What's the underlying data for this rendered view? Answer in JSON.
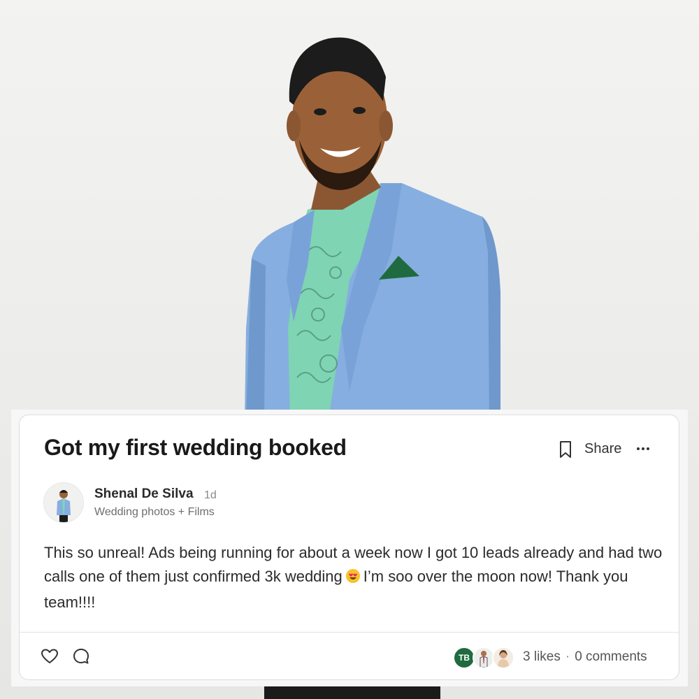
{
  "post": {
    "title": "Got my first wedding booked",
    "share_label": "Share",
    "author": {
      "name": "Shenal De Silva",
      "time": "1d",
      "subtitle": "Wedding photos + Films"
    },
    "body_part1": "This so unreal! Ads being running for about a week now I got 10 leads already and had two calls one of them just confirmed 3k wedding",
    "body_part2": "I’m soo over the moon now! Thank you team!!!!",
    "likers": [
      {
        "initials": "TB",
        "color": "#1f6b3f"
      }
    ],
    "likes_text": "3 likes",
    "separator": "·",
    "comments_text": "0 comments"
  },
  "icons": [
    "bookmark-icon",
    "more-icon",
    "heart-icon",
    "comment-icon",
    "heart-eyes-emoji"
  ],
  "colors": {
    "blazer": "#86aee0",
    "shirt": "#7fd4b4",
    "pocket_square": "#1f6b3f",
    "card_border": "#dcdcdc"
  }
}
